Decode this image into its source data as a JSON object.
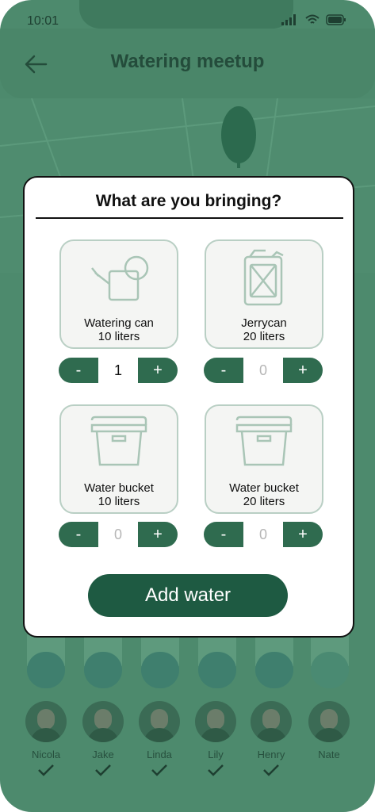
{
  "status": {
    "time": "10:01"
  },
  "header": {
    "title": "Watering meetup"
  },
  "modal": {
    "title": "What are you bringing?",
    "items": [
      {
        "name": "Watering can",
        "capacity": "10 liters",
        "quantity": "1"
      },
      {
        "name": "Jerrycan",
        "capacity": "20 liters",
        "quantity": "0"
      },
      {
        "name": "Water bucket",
        "capacity": "10 liters",
        "quantity": "0"
      },
      {
        "name": "Water bucket",
        "capacity": "20 liters",
        "quantity": "0"
      }
    ],
    "minus_label": "-",
    "plus_label": "+",
    "add_button": "Add water"
  },
  "participants": [
    {
      "name": "Nicola"
    },
    {
      "name": "Jake"
    },
    {
      "name": "Linda"
    },
    {
      "name": "Lily"
    },
    {
      "name": "Henry"
    },
    {
      "name": "Nate"
    }
  ],
  "colors": {
    "primary": "#1e5a42",
    "background": "#4d8a6d",
    "card_border": "#b9cfc4"
  }
}
